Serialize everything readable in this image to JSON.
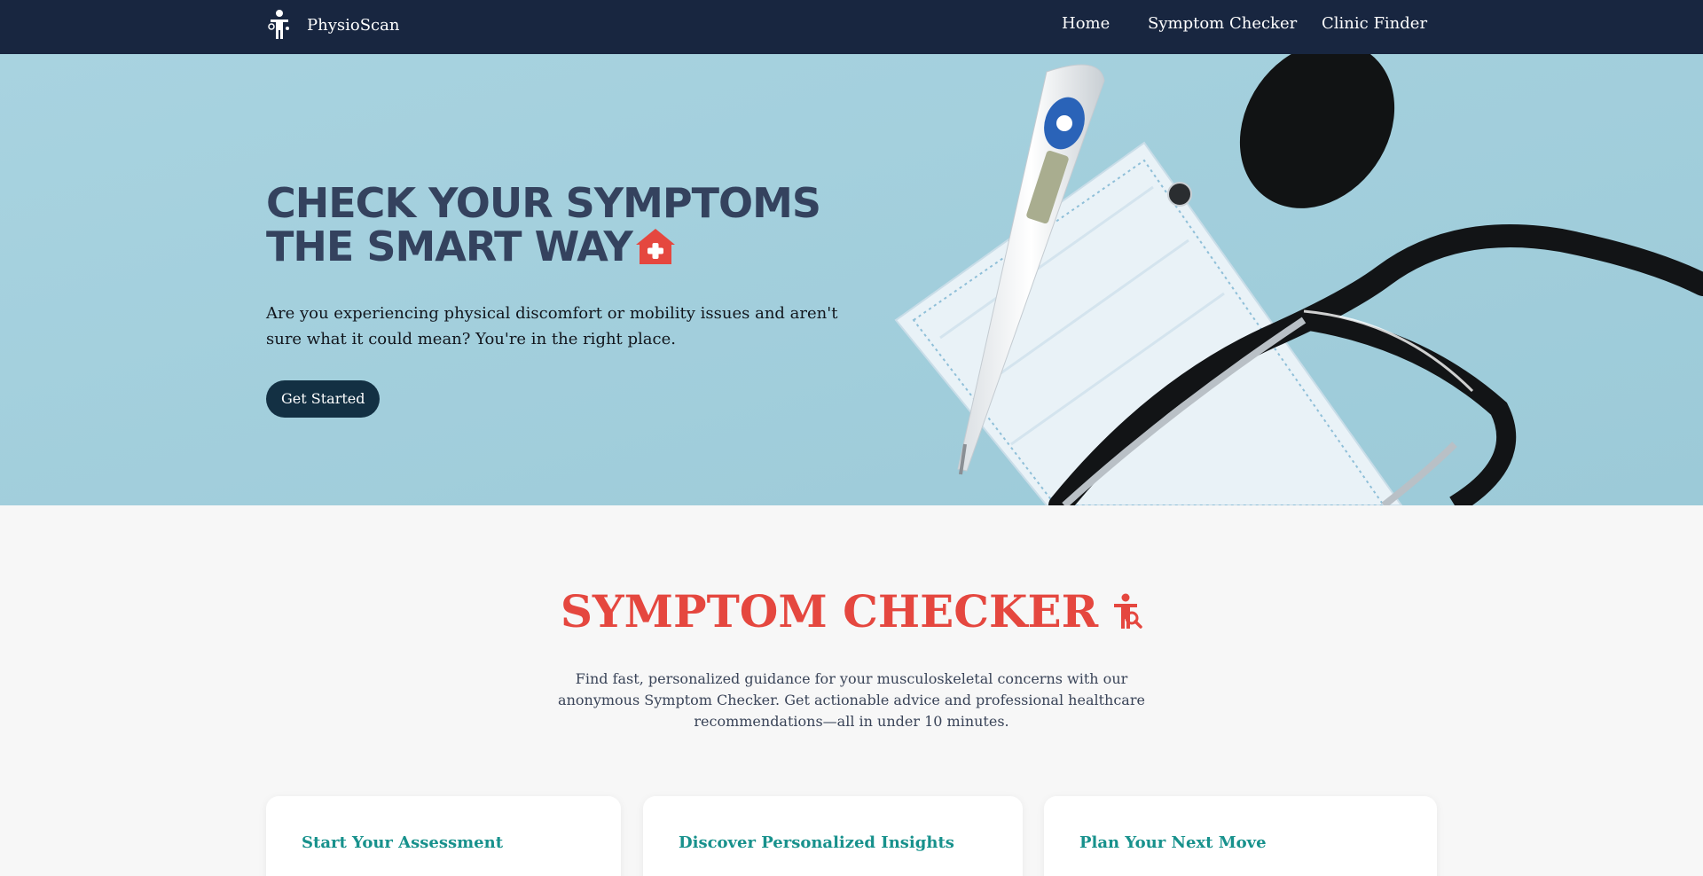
{
  "nav": {
    "brand_name": "PhysioScan",
    "brand_icon": "person-figure-icon",
    "links": [
      "Home",
      "Symptom Checker",
      "Clinic Finder"
    ]
  },
  "hero": {
    "title_line1": "CHECK YOUR SYMPTOMS",
    "title_line2": "THE SMART WAY",
    "title_icon": "medical-house-icon",
    "subtitle": "Are you experiencing physical discomfort or mobility issues and aren't sure what it could mean? You're in the right place.",
    "button_label": "Get Started"
  },
  "section": {
    "title": "SYMPTOM CHECKER",
    "title_icon": "person-search-icon",
    "description": "Find fast, personalized guidance for your musculoskeletal concerns with our anonymous Symptom Checker. Get actionable advice and professional healthcare recommendations—all in under 10 minutes."
  },
  "cards": [
    {
      "title": "Start Your Assessment"
    },
    {
      "title": "Discover Personalized Insights"
    },
    {
      "title": "Plan Your Next Move"
    }
  ],
  "colors": {
    "nav_bg": "#182640",
    "hero_bg": "#a3cfdc",
    "accent_red": "#e5473f",
    "accent_teal": "#17918c",
    "button_bg": "#133043"
  }
}
